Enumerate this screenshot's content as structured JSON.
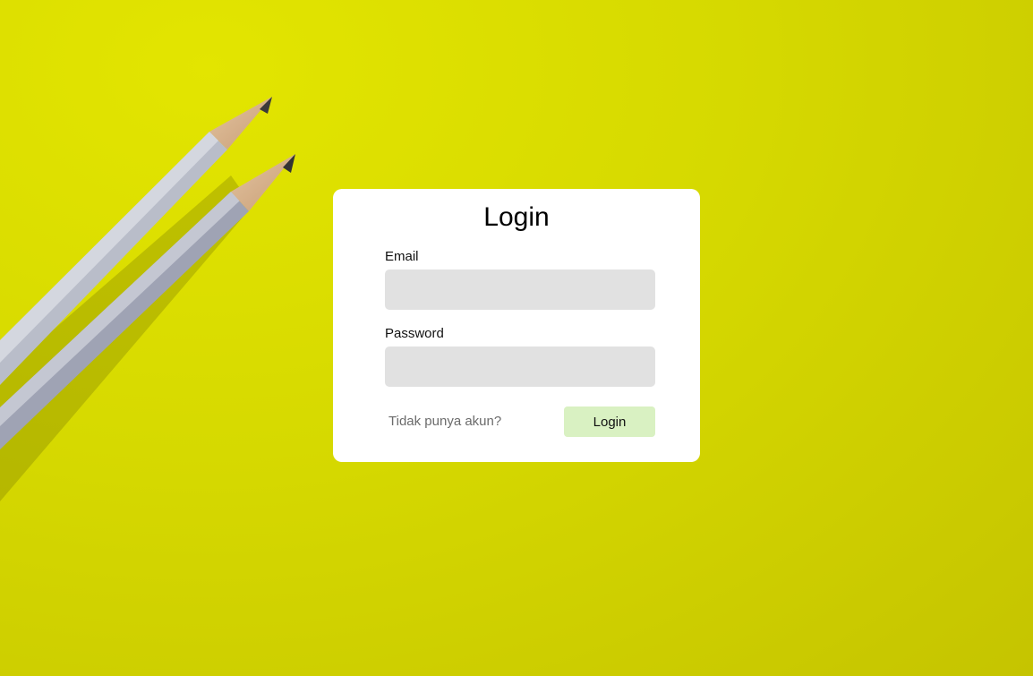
{
  "colors": {
    "background": "#d9dc00",
    "card": "#ffffff",
    "input_fill": "#e1e1e1",
    "login_button": "#d9f1c2"
  },
  "login_form": {
    "title": "Login",
    "email_label": "Email",
    "email_value": "",
    "password_label": "Password",
    "password_value": "",
    "signup_link": "Tidak punya akun?",
    "submit_label": "Login"
  }
}
